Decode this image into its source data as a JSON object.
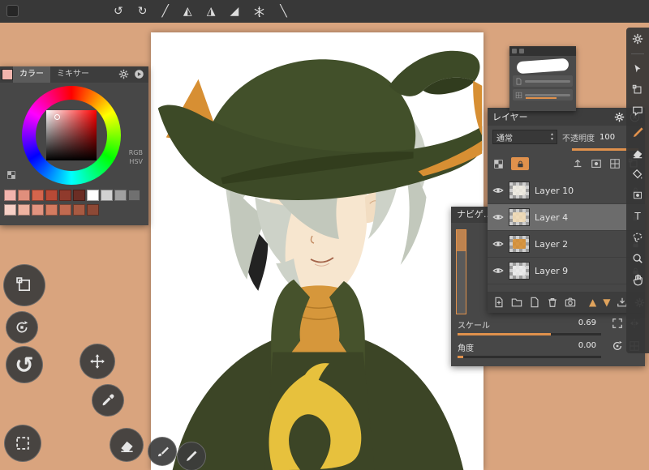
{
  "app": {
    "background": "#d9a47e",
    "topbar_bg": "#383838",
    "panel_bg": "#474747",
    "accent": "#e0914c"
  },
  "topbar": {
    "icons": [
      {
        "name": "undo",
        "glyph": "↺"
      },
      {
        "name": "redo",
        "glyph": "↻"
      },
      {
        "name": "pen-tool",
        "glyph": "╱"
      },
      {
        "name": "scatter-brush",
        "glyph": "◭"
      },
      {
        "name": "pattern-brush",
        "glyph": "◮"
      },
      {
        "name": "gradient-tool",
        "glyph": "◢"
      },
      {
        "name": "snowflake-brush"
      },
      {
        "name": "line-tool",
        "glyph": "╲"
      }
    ]
  },
  "color_panel": {
    "tabs": [
      {
        "label": "カラー"
      },
      {
        "label": "ミキサー"
      }
    ],
    "current_color": "#f2b4ad",
    "mode_rgb": "RGB",
    "mode_hsv": "HSV",
    "swatches_row1": [
      "#f2b4ad",
      "#e08f7c",
      "#d4654c",
      "#b84a36",
      "#8f3a2c",
      "#6b2d24",
      "#ffffff",
      "#d2d2d2",
      "#a0a0a0",
      "#707070"
    ],
    "swatches_row2": [
      "#f6d0c6",
      "#eeb2a0",
      "#e29480",
      "#d47b60",
      "#c16a50",
      "#a85a42",
      "#8d4936"
    ]
  },
  "quick_tools": [
    {
      "name": "transform"
    },
    {
      "name": "rotate-reset"
    },
    {
      "name": "undo",
      "glyph": "↺"
    },
    {
      "name": "move"
    },
    {
      "name": "eyedropper"
    },
    {
      "name": "select"
    },
    {
      "name": "eraser"
    },
    {
      "name": "brush"
    },
    {
      "name": "pen-settings"
    }
  ],
  "brush_panel": {
    "icons": [
      {
        "name": "dock"
      },
      {
        "name": "pin"
      }
    ]
  },
  "layers_panel": {
    "title": "レイヤー",
    "blend_mode": "通常",
    "opacity_label": "不透明度",
    "opacity_value": "100",
    "layers": [
      {
        "name": "Layer 10",
        "thumb": "#f0ece2",
        "selected": false
      },
      {
        "name": "Layer 4",
        "thumb": "#f2dbb6",
        "selected": true
      },
      {
        "name": "Layer 2",
        "thumb": "#d78f33",
        "selected": false
      },
      {
        "name": "Layer 9",
        "thumb": "#ececec",
        "selected": false
      }
    ]
  },
  "navigator_panel": {
    "title": "ナビゲ...",
    "scale_label": "スケール",
    "scale_value": "0.69",
    "angle_label": "角度",
    "angle_value": "0.00"
  },
  "side_tools": [
    {
      "name": "settings"
    },
    {
      "name": "move-cursor"
    },
    {
      "name": "transform-box"
    },
    {
      "name": "speech-bubble"
    },
    {
      "name": "brush",
      "active": true
    },
    {
      "name": "eraser"
    },
    {
      "name": "fill-bucket"
    },
    {
      "name": "shape"
    },
    {
      "name": "text",
      "glyph": "T"
    },
    {
      "name": "lasso"
    },
    {
      "name": "zoom"
    },
    {
      "name": "hand"
    }
  ],
  "artwork": {
    "background": "#ffffff",
    "hat": "#3d4a27",
    "hat_crown": "#42502a",
    "hair": "#cdd2c8",
    "hair_shade": "#c2c8bc",
    "skin": "#f7e6cf",
    "eye": "#4d7c33",
    "cloak": "#3c4526",
    "collar": "#46522c",
    "sweater": "#d6973b",
    "tail": "#e7c13d",
    "accent_orange": "#d78f33"
  }
}
